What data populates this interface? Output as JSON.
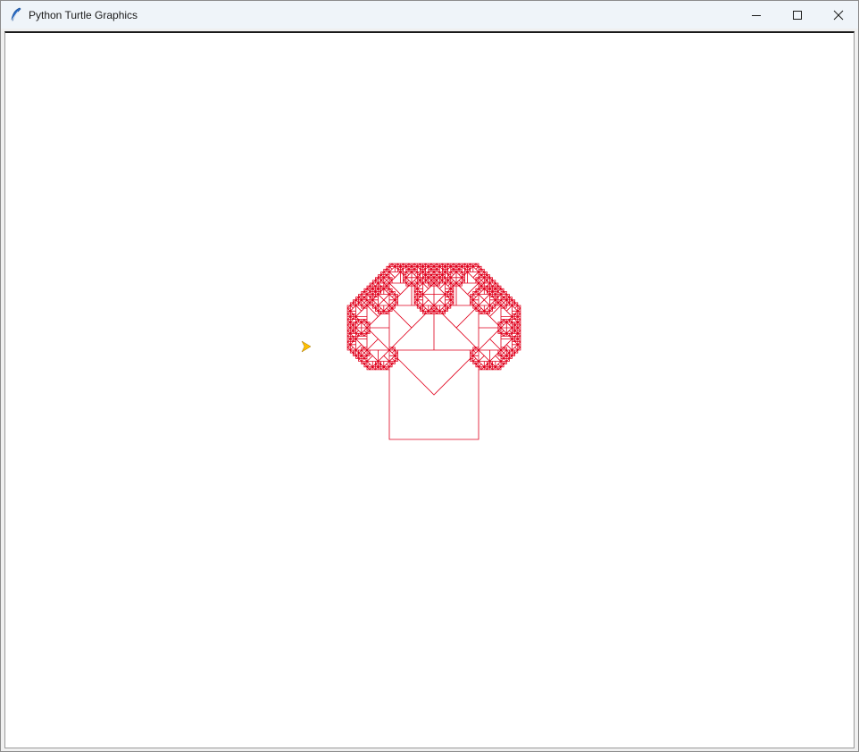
{
  "window": {
    "title": "Python Turtle Graphics",
    "app_icon": "feather-icon",
    "controls": {
      "minimize_icon": "minimize-icon",
      "maximize_icon": "maximize-icon",
      "close_icon": "close-icon"
    }
  },
  "canvas": {
    "background": "#ffffff",
    "pen_color": "#e0001c",
    "turtle_color": "#ffc000",
    "fractal": "pythagoras-tree",
    "recursion_depth": 10,
    "branch_angle_degrees": 45
  }
}
